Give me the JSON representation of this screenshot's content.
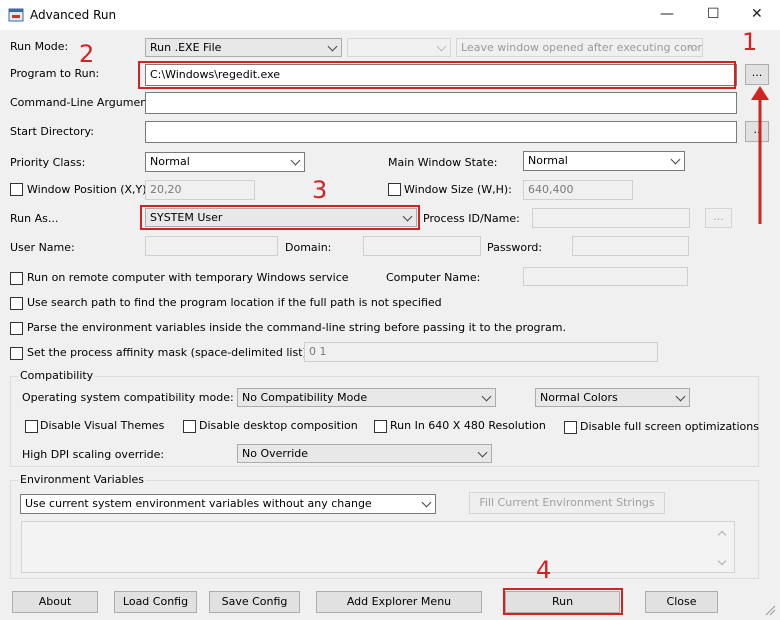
{
  "window": {
    "title": "Advanced Run",
    "min": "—",
    "max": "☐",
    "close": "✕"
  },
  "run_mode": {
    "label": "Run Mode:",
    "value": "Run .EXE File",
    "after_exec": "Leave window opened after executing comman"
  },
  "program": {
    "label": "Program to Run:",
    "value": "C:\\Windows\\regedit.exe",
    "browse": "..."
  },
  "cmdline": {
    "label": "Command-Line Arguments:",
    "value": ""
  },
  "startdir": {
    "label": "Start Directory:",
    "value": "",
    "browse": ".."
  },
  "priority": {
    "label": "Priority Class:",
    "value": "Normal"
  },
  "main_state": {
    "label": "Main Window State:",
    "value": "Normal"
  },
  "winpos": {
    "label": "Window Position (X,Y):",
    "value": "20,20"
  },
  "winsize": {
    "label": "Window Size (W,H):",
    "value": "640,400"
  },
  "run_as": {
    "label": "Run As...",
    "value": "SYSTEM User",
    "pid_label": "Process ID/Name:",
    "pid_btn": "..."
  },
  "user": {
    "label": "User Name:",
    "domain_label": "Domain:",
    "password_label": "Password:"
  },
  "remote": {
    "label": "Run on remote computer with temporary Windows service",
    "computer_label": "Computer Name:"
  },
  "search_path": {
    "label": "Use search path to find the program location if the full path is not specified"
  },
  "parse_env": {
    "label": "Parse the environment variables inside the command-line string before passing it to the program."
  },
  "affinity": {
    "label": "Set the process affinity mask (space-delimited list):",
    "value": "0 1"
  },
  "compat": {
    "title": "Compatibility",
    "os_label": "Operating system compatibility mode:",
    "os_value": "No Compatibility Mode",
    "colors_value": "Normal Colors",
    "visual_themes": "Disable Visual Themes",
    "desktop_comp": "Disable desktop composition",
    "res640": "Run In 640 X 480 Resolution",
    "fullscreen": "Disable full screen optimizations",
    "dpi_label": "High DPI scaling override:",
    "dpi_value": "No Override"
  },
  "env": {
    "title": "Environment Variables",
    "value": "Use current system environment variables without any change",
    "fill_btn": "Fill Current Environment Strings"
  },
  "buttons": {
    "about": "About",
    "load": "Load Config",
    "save": "Save Config",
    "explorer": "Add Explorer Menu",
    "run": "Run",
    "close": "Close"
  },
  "annotations": {
    "n1": "1",
    "n2": "2",
    "n3": "3",
    "n4": "4"
  },
  "colors": {
    "annotation": "#d42222"
  }
}
